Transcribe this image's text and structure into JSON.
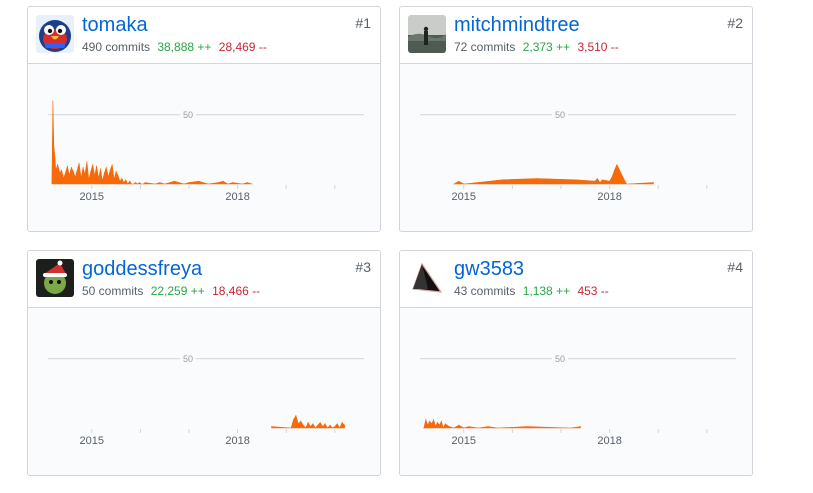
{
  "colors": {
    "link": "#0366d6",
    "additions": "#28a745",
    "deletions": "#cb2431",
    "chart_fill": "#f66a0a",
    "grid": "#d1d5da"
  },
  "contributors": [
    {
      "rank": "#1",
      "username": "tomaka",
      "commits": "490 commits",
      "additions": "38,888 ++",
      "deletions": "28,469 --",
      "avatar_icon": "parrot-avatar-icon"
    },
    {
      "rank": "#2",
      "username": "mitchmindtree",
      "commits": "72 commits",
      "additions": "2,373 ++",
      "deletions": "3,510 --",
      "avatar_icon": "landscape-photo-avatar-icon"
    },
    {
      "rank": "#3",
      "username": "goddessfreya",
      "commits": "50 commits",
      "additions": "22,259 ++",
      "deletions": "18,466 --",
      "avatar_icon": "santa-hat-avatar-icon"
    },
    {
      "rank": "#4",
      "username": "gw3583",
      "commits": "43 commits",
      "additions": "1,138 ++",
      "deletions": "453 --",
      "avatar_icon": "triangle-avatar-icon"
    }
  ],
  "chart_data": [
    {
      "type": "area",
      "x_ticks": [
        "2015",
        "2018"
      ],
      "gridline_label": "50",
      "ylim": [
        0,
        65
      ],
      "x_range": [
        2014.1,
        2020.6
      ],
      "x": [
        2014.18,
        2014.2,
        2014.22,
        2014.24,
        2014.26,
        2014.3,
        2014.34,
        2014.38,
        2014.42,
        2014.46,
        2014.5,
        2014.54,
        2014.58,
        2014.62,
        2014.66,
        2014.7,
        2014.74,
        2014.78,
        2014.82,
        2014.86,
        2014.9,
        2014.94,
        2014.98,
        2015.02,
        2015.06,
        2015.1,
        2015.14,
        2015.18,
        2015.22,
        2015.26,
        2015.3,
        2015.34,
        2015.38,
        2015.42,
        2015.46,
        2015.5,
        2015.54,
        2015.58,
        2015.62,
        2015.66,
        2015.7,
        2015.74,
        2015.78,
        2015.82,
        2015.86,
        2015.9,
        2015.94,
        2015.98,
        2016.02,
        2016.06,
        2016.1,
        2016.3,
        2016.4,
        2016.5,
        2016.7,
        2016.9,
        2017.0,
        2017.2,
        2017.4,
        2017.6,
        2017.7,
        2017.8,
        2017.9,
        2018.1,
        2018.2,
        2018.3
      ],
      "values": [
        2,
        60,
        28,
        20,
        10,
        14,
        8,
        10,
        4,
        8,
        13,
        6,
        12,
        9,
        5,
        10,
        15,
        4,
        12,
        7,
        16,
        3,
        9,
        14,
        6,
        13,
        4,
        11,
        2,
        8,
        12,
        5,
        10,
        14,
        3,
        9,
        6,
        2,
        4,
        1,
        3,
        0,
        2,
        0,
        0,
        1,
        0,
        1,
        0,
        0,
        1,
        0,
        1,
        0,
        2,
        0,
        1,
        2,
        0,
        1,
        2,
        0,
        1,
        0,
        1,
        0
      ]
    },
    {
      "type": "area",
      "x_ticks": [
        "2015",
        "2018"
      ],
      "gridline_label": "50",
      "ylim": [
        0,
        65
      ],
      "x_range": [
        2014.1,
        2020.6
      ],
      "x": [
        2014.8,
        2014.9,
        2015.0,
        2015.8,
        2016.5,
        2017.3,
        2017.7,
        2017.75,
        2017.8,
        2017.85,
        2018.0,
        2018.05,
        2018.1,
        2018.15,
        2018.3,
        2018.35,
        2018.9
      ],
      "values": [
        0,
        2,
        0,
        3,
        4,
        3,
        2,
        4,
        1,
        3,
        2,
        5,
        10,
        14,
        3,
        0,
        1
      ]
    },
    {
      "type": "area",
      "x_ticks": [
        "2015",
        "2018"
      ],
      "gridline_label": "50",
      "ylim": [
        0,
        65
      ],
      "x_range": [
        2014.1,
        2020.6
      ],
      "x": [
        2018.7,
        2019.1,
        2019.15,
        2019.2,
        2019.25,
        2019.3,
        2019.35,
        2019.4,
        2019.45,
        2019.5,
        2019.55,
        2019.6,
        2019.65,
        2019.7,
        2019.75,
        2019.8,
        2019.85,
        2019.9,
        2019.95,
        2020.0,
        2020.05,
        2020.1,
        2020.15,
        2020.2
      ],
      "values": [
        1,
        0,
        6,
        9,
        3,
        5,
        2,
        0,
        4,
        1,
        3,
        0,
        2,
        4,
        1,
        3,
        0,
        2,
        0,
        1,
        3,
        0,
        4,
        2
      ]
    },
    {
      "type": "area",
      "x_ticks": [
        "2015",
        "2018"
      ],
      "gridline_label": "50",
      "ylim": [
        0,
        65
      ],
      "x_range": [
        2014.1,
        2020.6
      ],
      "x": [
        2014.18,
        2014.22,
        2014.26,
        2014.3,
        2014.34,
        2014.38,
        2014.42,
        2014.46,
        2014.5,
        2014.54,
        2014.58,
        2014.62,
        2014.7,
        2014.8,
        2014.9,
        2015.0,
        2015.1,
        2015.3,
        2015.5,
        2015.7,
        2016.3,
        2017.2,
        2017.4
      ],
      "values": [
        0,
        6,
        2,
        5,
        3,
        6,
        1,
        4,
        2,
        5,
        0,
        3,
        1,
        0,
        2,
        0,
        1,
        0,
        1,
        0,
        1,
        0,
        1
      ]
    }
  ]
}
